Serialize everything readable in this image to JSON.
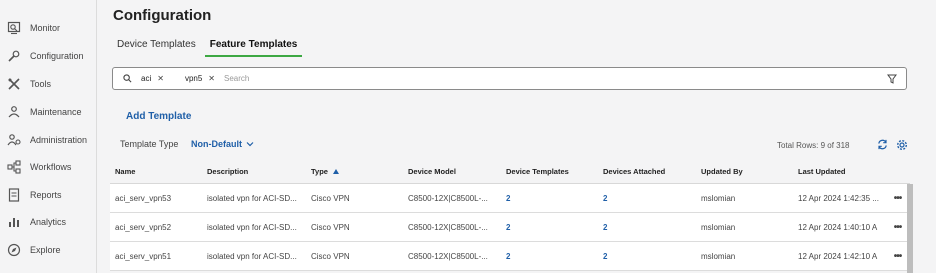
{
  "sidebar": {
    "items": [
      {
        "label": "Monitor",
        "icon": "monitor-icon"
      },
      {
        "label": "Configuration",
        "icon": "wrench-icon"
      },
      {
        "label": "Tools",
        "icon": "tools-icon"
      },
      {
        "label": "Maintenance",
        "icon": "maintenance-icon"
      },
      {
        "label": "Administration",
        "icon": "admin-icon"
      },
      {
        "label": "Workflows",
        "icon": "workflows-icon"
      },
      {
        "label": "Reports",
        "icon": "reports-icon"
      },
      {
        "label": "Analytics",
        "icon": "analytics-icon"
      },
      {
        "label": "Explore",
        "icon": "explore-icon"
      }
    ]
  },
  "header": {
    "title": "Configuration"
  },
  "tabs": [
    {
      "label": "Device Templates",
      "active": false
    },
    {
      "label": "Feature Templates",
      "active": true
    }
  ],
  "search": {
    "chips": [
      "aci",
      "vpn5"
    ],
    "placeholder": "Search"
  },
  "toolbar": {
    "add_label": "Add Template",
    "template_type_label": "Template Type",
    "template_type_value": "Non-Default",
    "total_rows": "Total Rows: 9 of 318"
  },
  "table": {
    "columns": [
      "Name",
      "Description",
      "Type",
      "Device Model",
      "Device Templates",
      "Devices Attached",
      "Updated By",
      "Last Updated"
    ],
    "rows": [
      {
        "name": "aci_serv_vpn53",
        "description": "isolated vpn for ACI-SD...",
        "type": "Cisco VPN",
        "model": "C8500-12X|C8500L-...",
        "device_templates": "2",
        "devices_attached": "2",
        "updated_by": "mslomian",
        "last_updated": "12 Apr 2024 1:42:35 ..."
      },
      {
        "name": "aci_serv_vpn52",
        "description": "isolated vpn for ACI-SD...",
        "type": "Cisco VPN",
        "model": "C8500-12X|C8500L-...",
        "device_templates": "2",
        "devices_attached": "2",
        "updated_by": "mslomian",
        "last_updated": "12 Apr 2024 1:40:10 A"
      },
      {
        "name": "aci_serv_vpn51",
        "description": "isolated vpn for ACI-SD...",
        "type": "Cisco VPN",
        "model": "C8500-12X|C8500L-...",
        "device_templates": "2",
        "devices_attached": "2",
        "updated_by": "mslomian",
        "last_updated": "12 Apr 2024 1:42:10 A"
      }
    ],
    "row_action": "•••"
  },
  "colors": {
    "accent": "#1f5fa8",
    "active_tab": "#3da843"
  }
}
